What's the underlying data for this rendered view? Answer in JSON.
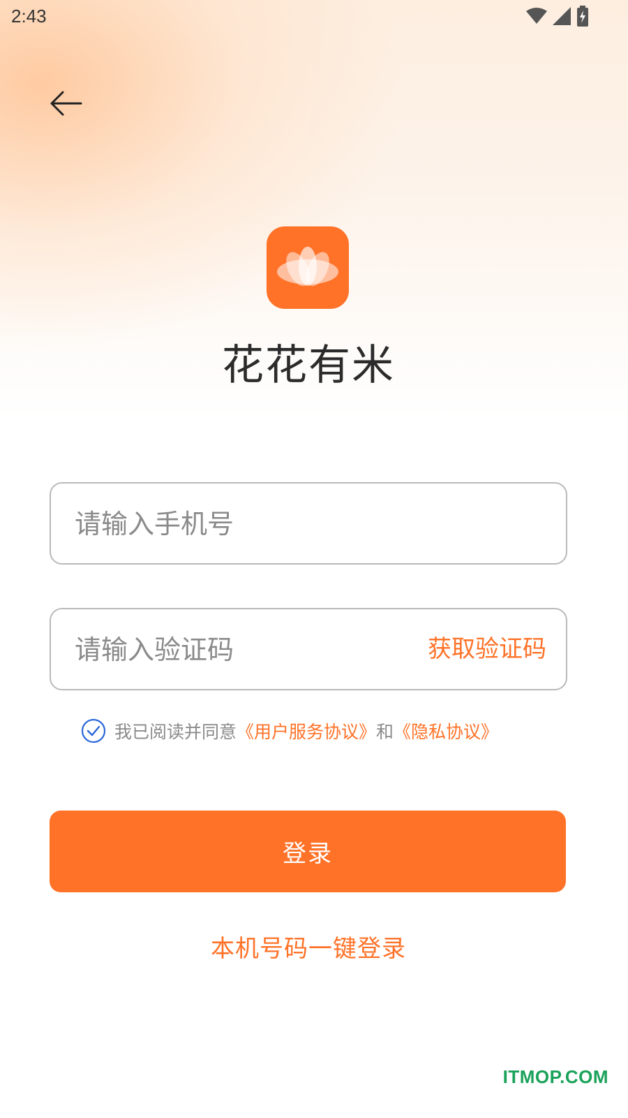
{
  "status_bar": {
    "time": "2:43",
    "icons": [
      "wifi-icon",
      "cellular-signal-icon",
      "battery-charging-icon"
    ]
  },
  "header": {
    "back_icon": "arrow-left-icon"
  },
  "app": {
    "name": "花花有米",
    "logo_icon": "lotus-logo-icon",
    "brand_color": "#ff7228"
  },
  "form": {
    "phone_placeholder": "请输入手机号",
    "phone_value": "",
    "code_placeholder": "请输入验证码",
    "code_value": "",
    "get_code_label": "获取验证码"
  },
  "agreement": {
    "checked": true,
    "prefix": "我已阅读并同意",
    "user_agreement": "《用户服务协议》",
    "conjunction": "和",
    "privacy_policy": "《隐私协议》"
  },
  "actions": {
    "login_label": "登录",
    "one_click_login_label": "本机号码一键登录"
  },
  "watermark": "ITMOP.COM"
}
